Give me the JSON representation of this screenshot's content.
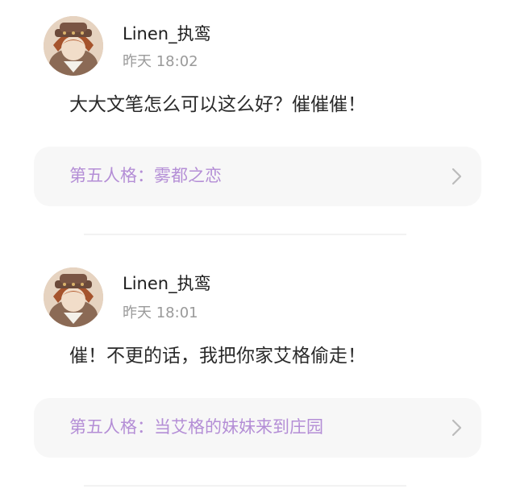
{
  "comments": [
    {
      "username": "Linen_执鸾",
      "time": "昨天 18:02",
      "content": "大大文笔怎么可以这么好？催催催！",
      "work_title": "第五人格：雾都之恋"
    },
    {
      "username": "Linen_执鸾",
      "time": "昨天 18:01",
      "content": "催！不更的话，我把你家艾格偷走！",
      "work_title": "第五人格：当艾格的妹妹来到庄园"
    }
  ],
  "colors": {
    "accent": "#b48ed6",
    "time_gray": "#9a9a9a",
    "card_bg": "#f7f7f7"
  },
  "icons": {
    "avatar": "avatar",
    "chevron": "chevron-right-icon"
  }
}
